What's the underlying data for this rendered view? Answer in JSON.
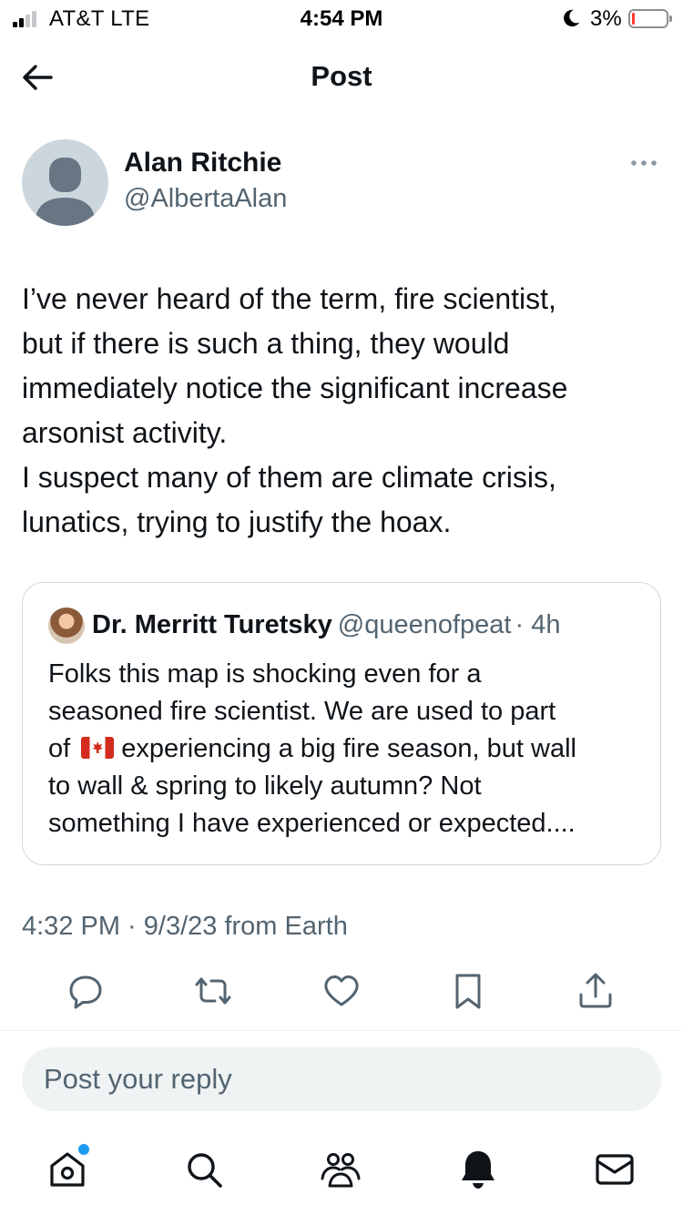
{
  "status_bar": {
    "carrier": "AT&T  LTE",
    "time": "4:54 PM",
    "battery_percent": "3%",
    "battery_level": 0.03,
    "signal_bars": 2
  },
  "header": {
    "title": "Post",
    "back_icon": "arrow-left-icon"
  },
  "post": {
    "author_name": "Alan Ritchie",
    "author_handle": "@AlbertaAlan",
    "text_lines": [
      "I’ve never heard of the term, fire scientist,",
      "but if there is such a thing, they would",
      "immediately notice the significant increase",
      "arsonist activity.",
      "I suspect many of them are climate crisis,",
      "lunatics, trying to justify the hoax."
    ],
    "meta": "4:32 PM · 9/3/23 from Earth"
  },
  "quote": {
    "author_name": "Dr. Merritt Turetsky",
    "author_handle": "@queenofpeat",
    "time_ago": "· 4h",
    "line1": "Folks this map is shocking even for a",
    "line2": "seasoned fire scientist. We are used to part",
    "line3_pre": "of",
    "line3_flag_icon": "canada-flag-icon",
    "line3_post": "experiencing a big fire season, but wall",
    "line4": "to wall & spring to likely autumn?  Not",
    "line5": "something I have experienced or expected...."
  },
  "actions": [
    "reply-icon",
    "repost-icon",
    "like-icon",
    "bookmark-icon",
    "share-icon"
  ],
  "reply": {
    "placeholder": "Post your reply"
  },
  "tab_bar": {
    "items": [
      "home-icon",
      "search-icon",
      "communities-icon",
      "notifications-icon",
      "messages-icon"
    ]
  },
  "colors": {
    "text_primary": "#0f1419",
    "text_secondary": "#536471",
    "border": "#cfd9de",
    "input_bg": "#eff3f4",
    "accent": "#1d9bf0",
    "battery_low": "#ff3b30"
  }
}
